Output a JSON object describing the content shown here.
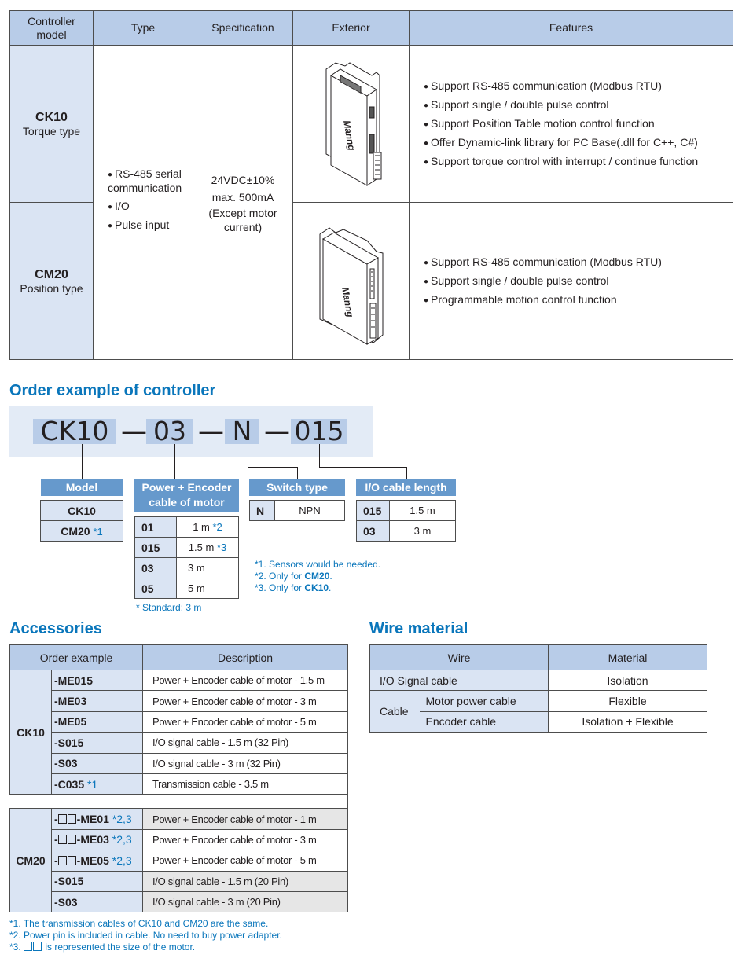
{
  "spec_table": {
    "headers": [
      "Controller model",
      "Type",
      "Specification",
      "Exterior",
      "Features"
    ],
    "models": [
      {
        "name": "CK10",
        "subtitle": "Torque type",
        "exterior_image": "ck10-controller-drawing",
        "features": [
          "Support RS-485 communication (Modbus RTU)",
          "Support single / double pulse control",
          "Support Position Table motion control function",
          "Offer Dynamic-link library for PC Base(.dll for C++, C#)",
          "Support torque control with interrupt / continue function"
        ]
      },
      {
        "name": "CM20",
        "subtitle": "Position type",
        "exterior_image": "cm20-controller-drawing",
        "features": [
          "Support RS-485 communication (Modbus RTU)",
          "Support single / double pulse control",
          "Programmable motion control function"
        ]
      }
    ],
    "type_items": [
      "RS-485 serial communication",
      "I/O",
      "Pulse input"
    ],
    "specification": [
      "24VDC±10%",
      "max. 500mA",
      "(Except motor",
      "current)"
    ]
  },
  "order_example": {
    "title": "Order example of controller",
    "code_segments": [
      "CK10",
      "03",
      "N",
      "015"
    ],
    "separator": "—",
    "model": {
      "title": "Model",
      "rows": [
        {
          "code": "CK10",
          "note": ""
        },
        {
          "code": "CM20",
          "note": "*1"
        }
      ]
    },
    "power_encoder": {
      "title_line1": "Power + Encoder",
      "title_line2": "cable of motor",
      "rows": [
        {
          "code": "01",
          "value": "1 m",
          "note": "*2"
        },
        {
          "code": "015",
          "value": "1.5 m",
          "note": "*3"
        },
        {
          "code": "03",
          "value": "3 m",
          "note": ""
        },
        {
          "code": "05",
          "value": "5 m",
          "note": ""
        }
      ],
      "standard_note": "* Standard: 3 m"
    },
    "switch_type": {
      "title": "Switch type",
      "rows": [
        {
          "code": "N",
          "value": "NPN"
        }
      ]
    },
    "io_cable_length": {
      "title": "I/O cable length",
      "rows": [
        {
          "code": "015",
          "value": "1.5 m"
        },
        {
          "code": "03",
          "value": "3 m"
        }
      ]
    },
    "notes": [
      {
        "prefix": "*1. Sensors would be needed.",
        "bold": ""
      },
      {
        "prefix": "*2. Only for ",
        "bold": "CM20",
        "suffix": "."
      },
      {
        "prefix": "*3. Only for ",
        "bold": "CK10",
        "suffix": "."
      }
    ]
  },
  "accessories": {
    "title": "Accessories",
    "headers": [
      "Order example",
      "Description"
    ],
    "groups": [
      {
        "model": "CK10",
        "rows": [
          {
            "code": "-ME015",
            "note": "",
            "desc": "Power + Encoder cable of motor - 1.5 m"
          },
          {
            "code": "-ME03",
            "note": "",
            "desc": "Power + Encoder cable of motor - 3 m"
          },
          {
            "code": "-ME05",
            "note": "",
            "desc": "Power + Encoder cable of motor - 5 m"
          },
          {
            "code": "-S015",
            "note": "",
            "desc": "I/O signal cable - 1.5 m (32 Pin)"
          },
          {
            "code": "-S03",
            "note": "",
            "desc": "I/O signal cable - 3 m (32 Pin)"
          },
          {
            "code": "-C035",
            "note": "*1",
            "desc": "Transmission cable - 3.5 m"
          }
        ]
      },
      {
        "model": "CM20",
        "rows": [
          {
            "code_prefix": "-",
            "code": "-ME01",
            "note": "*2,3",
            "desc": "Power + Encoder cable of motor - 1 m",
            "shaded": true
          },
          {
            "code_prefix": "-",
            "code": "-ME03",
            "note": "*2,3",
            "desc": "Power + Encoder cable of motor - 3 m",
            "shaded": false
          },
          {
            "code_prefix": "-",
            "code": "-ME05",
            "note": "*2,3",
            "desc": "Power + Encoder cable of motor - 5 m",
            "shaded": false
          },
          {
            "code": "-S015",
            "note": "",
            "desc": "I/O signal cable -  1.5 m (20 Pin)",
            "shaded": true
          },
          {
            "code": "-S03",
            "note": "",
            "desc": "I/O signal cable - 3 m (20 Pin)",
            "shaded": true
          }
        ]
      }
    ],
    "footnotes": [
      "*1. The transmission cables of CK10 and CM20 are the same.",
      "*2. Power pin is included in cable. No need to buy power adapter.",
      "is represented the size of the motor."
    ],
    "footnote3_prefix": "*3."
  },
  "wire_material": {
    "title": "Wire material",
    "headers": [
      "Wire",
      "Material"
    ],
    "rows": [
      {
        "wire": "I/O Signal cable",
        "material": "Isolation"
      },
      {
        "group": "Cable",
        "wire": "Motor power cable",
        "material": "Flexible"
      },
      {
        "group": "Cable",
        "wire": "Encoder cable",
        "material": "Isolation + Flexible"
      }
    ]
  },
  "colors": {
    "header_blue": "#b8cce8",
    "light_blue": "#dae4f3",
    "title_blue": "#0a76bb",
    "box_title_blue": "#6699cc",
    "shaded_gray": "#e6e6e6"
  }
}
